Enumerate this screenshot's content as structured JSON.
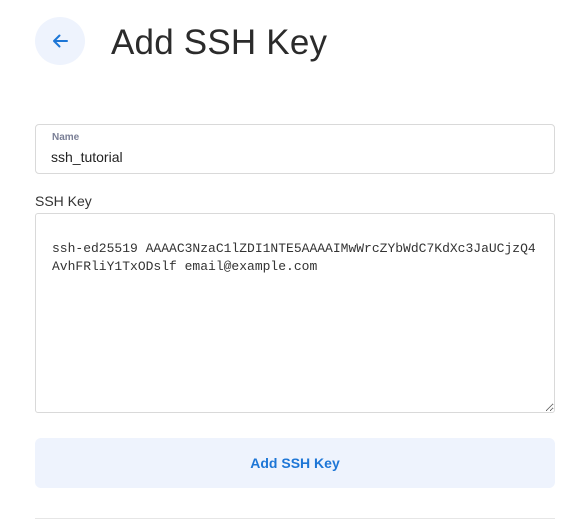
{
  "header": {
    "title": "Add SSH Key",
    "back_icon": "arrow-left-icon"
  },
  "form": {
    "name_label": "Name",
    "name_value": "ssh_tutorial",
    "ssh_label": "SSH Key",
    "ssh_value": "ssh-ed25519 AAAAC3NzaC1lZDI1NTE5AAAAIMwWrcZYbWdC7KdXc3JaUCjzQ4AvhFRliY1TxODslf email@example.com",
    "submit_label": "Add SSH Key"
  },
  "colors": {
    "accent": "#1d76d6",
    "button_bg": "#eef3fd",
    "border": "#d9d9d9"
  }
}
